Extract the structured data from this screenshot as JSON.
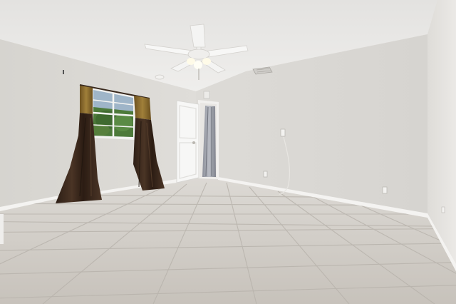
{
  "scene": {
    "description_hidden": "",
    "colors": {
      "ceiling": "#e9e8e6",
      "left_wall": "#dcdad6",
      "back_wall": "#d9d7d3",
      "right_wall": "#e7e5e2",
      "floor": "#cfcbc5",
      "tile_line": "#b9b4ad",
      "baseboard": "#f4f3f1",
      "curtain_dark": "#3d2a1f",
      "curtain_gold": "#8a6a2a",
      "door": "#f5f5f5",
      "foliage": "#4d7a3a"
    },
    "objects": [
      "ceiling-fan",
      "window",
      "left-curtain",
      "right-curtain",
      "open-door",
      "hallway-curtain",
      "air-vent",
      "wall-outlet"
    ]
  }
}
